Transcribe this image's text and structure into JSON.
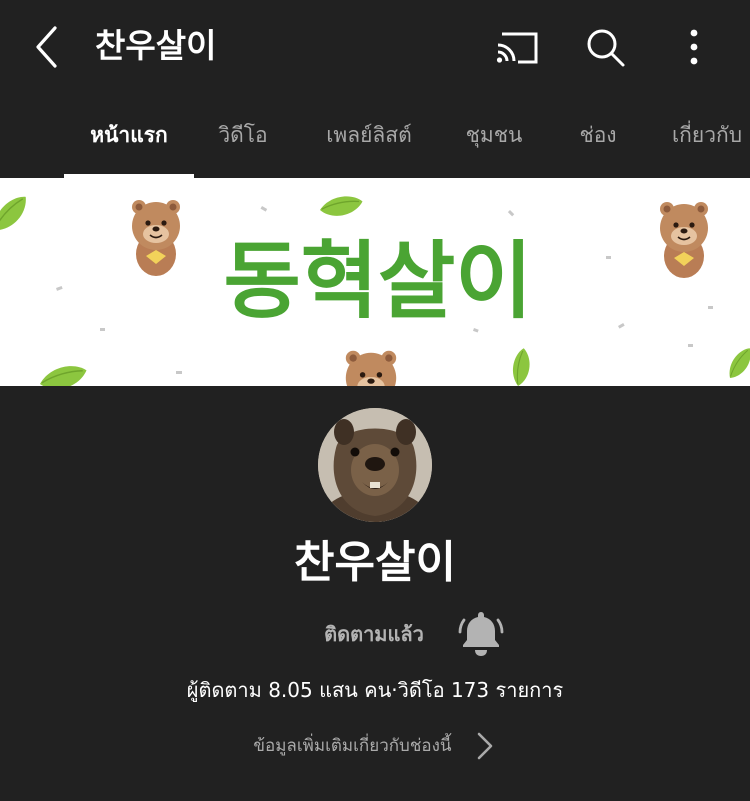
{
  "header": {
    "title": "찬우살이",
    "back_icon": "chevron-left-icon",
    "cast_icon": "cast-icon",
    "search_icon": "search-icon",
    "more_icon": "more-vertical-icon"
  },
  "tabs": [
    {
      "label": "หน้าแรก",
      "active": true
    },
    {
      "label": "วิดีโอ",
      "active": false
    },
    {
      "label": "เพลย์ลิสต์",
      "active": false
    },
    {
      "label": "ชุมชน",
      "active": false
    },
    {
      "label": "ช่อง",
      "active": false
    },
    {
      "label": "เกี่ยวกับ",
      "active": false
    }
  ],
  "banner": {
    "text": "동혁살이",
    "text_color": "#4aa433"
  },
  "channel": {
    "name": "찬우살이",
    "subscribed_label": "ติดตามแล้ว",
    "bell_icon": "bell-icon",
    "stats": "ผู้ติดตาม 8.05 แสน คน·วิดีโอ 173 รายการ",
    "more_info": "ข้อมูลเพิ่มเติมเกี่ยวกับช่องนี้",
    "more_info_icon": "chevron-right-icon"
  },
  "colors": {
    "background": "#212121",
    "text_primary": "#ffffff",
    "text_secondary": "#aaaaaa",
    "leaf_green": "#8cc63f",
    "quokka_brown": "#b97d55"
  }
}
